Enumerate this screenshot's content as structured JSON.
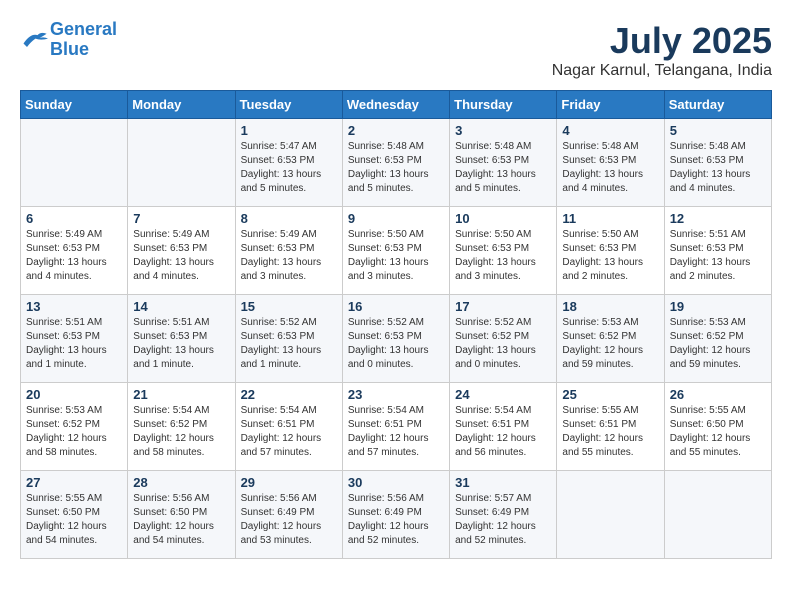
{
  "logo": {
    "line1": "General",
    "line2": "Blue"
  },
  "title": "July 2025",
  "location": "Nagar Karnul, Telangana, India",
  "days_of_week": [
    "Sunday",
    "Monday",
    "Tuesday",
    "Wednesday",
    "Thursday",
    "Friday",
    "Saturday"
  ],
  "weeks": [
    [
      {
        "day": "",
        "info": ""
      },
      {
        "day": "",
        "info": ""
      },
      {
        "day": "1",
        "info": "Sunrise: 5:47 AM\nSunset: 6:53 PM\nDaylight: 13 hours\nand 5 minutes."
      },
      {
        "day": "2",
        "info": "Sunrise: 5:48 AM\nSunset: 6:53 PM\nDaylight: 13 hours\nand 5 minutes."
      },
      {
        "day": "3",
        "info": "Sunrise: 5:48 AM\nSunset: 6:53 PM\nDaylight: 13 hours\nand 5 minutes."
      },
      {
        "day": "4",
        "info": "Sunrise: 5:48 AM\nSunset: 6:53 PM\nDaylight: 13 hours\nand 4 minutes."
      },
      {
        "day": "5",
        "info": "Sunrise: 5:48 AM\nSunset: 6:53 PM\nDaylight: 13 hours\nand 4 minutes."
      }
    ],
    [
      {
        "day": "6",
        "info": "Sunrise: 5:49 AM\nSunset: 6:53 PM\nDaylight: 13 hours\nand 4 minutes."
      },
      {
        "day": "7",
        "info": "Sunrise: 5:49 AM\nSunset: 6:53 PM\nDaylight: 13 hours\nand 4 minutes."
      },
      {
        "day": "8",
        "info": "Sunrise: 5:49 AM\nSunset: 6:53 PM\nDaylight: 13 hours\nand 3 minutes."
      },
      {
        "day": "9",
        "info": "Sunrise: 5:50 AM\nSunset: 6:53 PM\nDaylight: 13 hours\nand 3 minutes."
      },
      {
        "day": "10",
        "info": "Sunrise: 5:50 AM\nSunset: 6:53 PM\nDaylight: 13 hours\nand 3 minutes."
      },
      {
        "day": "11",
        "info": "Sunrise: 5:50 AM\nSunset: 6:53 PM\nDaylight: 13 hours\nand 2 minutes."
      },
      {
        "day": "12",
        "info": "Sunrise: 5:51 AM\nSunset: 6:53 PM\nDaylight: 13 hours\nand 2 minutes."
      }
    ],
    [
      {
        "day": "13",
        "info": "Sunrise: 5:51 AM\nSunset: 6:53 PM\nDaylight: 13 hours\nand 1 minute."
      },
      {
        "day": "14",
        "info": "Sunrise: 5:51 AM\nSunset: 6:53 PM\nDaylight: 13 hours\nand 1 minute."
      },
      {
        "day": "15",
        "info": "Sunrise: 5:52 AM\nSunset: 6:53 PM\nDaylight: 13 hours\nand 1 minute."
      },
      {
        "day": "16",
        "info": "Sunrise: 5:52 AM\nSunset: 6:53 PM\nDaylight: 13 hours\nand 0 minutes."
      },
      {
        "day": "17",
        "info": "Sunrise: 5:52 AM\nSunset: 6:52 PM\nDaylight: 13 hours\nand 0 minutes."
      },
      {
        "day": "18",
        "info": "Sunrise: 5:53 AM\nSunset: 6:52 PM\nDaylight: 12 hours\nand 59 minutes."
      },
      {
        "day": "19",
        "info": "Sunrise: 5:53 AM\nSunset: 6:52 PM\nDaylight: 12 hours\nand 59 minutes."
      }
    ],
    [
      {
        "day": "20",
        "info": "Sunrise: 5:53 AM\nSunset: 6:52 PM\nDaylight: 12 hours\nand 58 minutes."
      },
      {
        "day": "21",
        "info": "Sunrise: 5:54 AM\nSunset: 6:52 PM\nDaylight: 12 hours\nand 58 minutes."
      },
      {
        "day": "22",
        "info": "Sunrise: 5:54 AM\nSunset: 6:51 PM\nDaylight: 12 hours\nand 57 minutes."
      },
      {
        "day": "23",
        "info": "Sunrise: 5:54 AM\nSunset: 6:51 PM\nDaylight: 12 hours\nand 57 minutes."
      },
      {
        "day": "24",
        "info": "Sunrise: 5:54 AM\nSunset: 6:51 PM\nDaylight: 12 hours\nand 56 minutes."
      },
      {
        "day": "25",
        "info": "Sunrise: 5:55 AM\nSunset: 6:51 PM\nDaylight: 12 hours\nand 55 minutes."
      },
      {
        "day": "26",
        "info": "Sunrise: 5:55 AM\nSunset: 6:50 PM\nDaylight: 12 hours\nand 55 minutes."
      }
    ],
    [
      {
        "day": "27",
        "info": "Sunrise: 5:55 AM\nSunset: 6:50 PM\nDaylight: 12 hours\nand 54 minutes."
      },
      {
        "day": "28",
        "info": "Sunrise: 5:56 AM\nSunset: 6:50 PM\nDaylight: 12 hours\nand 54 minutes."
      },
      {
        "day": "29",
        "info": "Sunrise: 5:56 AM\nSunset: 6:49 PM\nDaylight: 12 hours\nand 53 minutes."
      },
      {
        "day": "30",
        "info": "Sunrise: 5:56 AM\nSunset: 6:49 PM\nDaylight: 12 hours\nand 52 minutes."
      },
      {
        "day": "31",
        "info": "Sunrise: 5:57 AM\nSunset: 6:49 PM\nDaylight: 12 hours\nand 52 minutes."
      },
      {
        "day": "",
        "info": ""
      },
      {
        "day": "",
        "info": ""
      }
    ]
  ]
}
